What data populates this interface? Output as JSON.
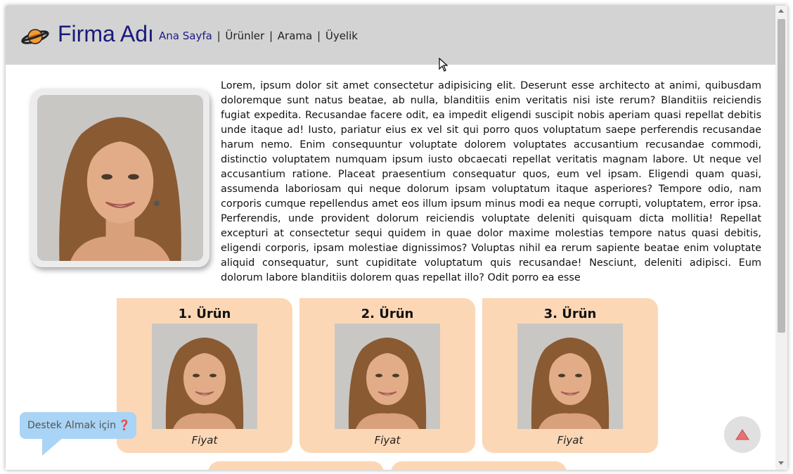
{
  "header": {
    "brand": "Firma Adı",
    "nav": [
      {
        "label": "Ana Sayfa"
      },
      {
        "label": "Ürünler"
      },
      {
        "label": "Arama"
      },
      {
        "label": "Üyelik"
      }
    ],
    "separator": "|"
  },
  "intro": {
    "text": "Lorem, ipsum dolor sit amet consectetur adipisicing elit. Deserunt esse architecto at animi, quibusdam doloremque sunt natus beatae, ab nulla, blanditiis enim veritatis nisi iste rerum? Blanditiis reiciendis fugiat expedita. Recusandae facere odit, ea impedit eligendi suscipit nobis aperiam quasi repellat debitis unde itaque ad! Iusto, pariatur eius ex vel sit qui porro quos voluptatum saepe perferendis recusandae harum nemo. Enim consequuntur voluptate dolorem voluptates accusantium recusandae commodi, distinctio voluptatem numquam ipsum iusto obcaecati repellat veritatis magnam labore. Ut neque vel accusantium ratione. Placeat praesentium consequatur quos, eum vel ipsam. Eligendi quam quasi, assumenda laboriosam qui neque dolorum ipsam voluptatum itaque asperiores? Tempore odio, nam corporis cumque repellendus amet eos illum ipsum minus modi ea neque corrupti, voluptatem, error ipsa. Perferendis, unde provident dolorum reiciendis voluptate deleniti quisquam dicta mollitia! Repellat excepturi at consectetur sequi quidem in quae dolor maxime molestias tempore natus quasi debitis, eligendi corporis, ipsam molestiae dignissimos? Voluptas nihil ea rerum sapiente beatae enim voluptate aliquid consequatur, sunt cupiditate voluptatum quis recusandae! Nesciunt, deleniti adipisci. Eum dolorum labore blanditiis dolorem quas repellat illo? Odit porro ea esse"
  },
  "products": [
    {
      "title": "1. Ürün",
      "price": "Fiyat"
    },
    {
      "title": "2. Ürün",
      "price": "Fiyat"
    },
    {
      "title": "3. Ürün",
      "price": "Fiyat"
    }
  ],
  "support": {
    "label": "Destek Almak için",
    "icon": "❓"
  },
  "colors": {
    "header_bg": "#d3d3d3",
    "brand_color": "#1a1a7a",
    "card_bg": "#fcd7b5",
    "support_bg": "#a9d4f5",
    "to_top_arrow": "#e57373"
  }
}
